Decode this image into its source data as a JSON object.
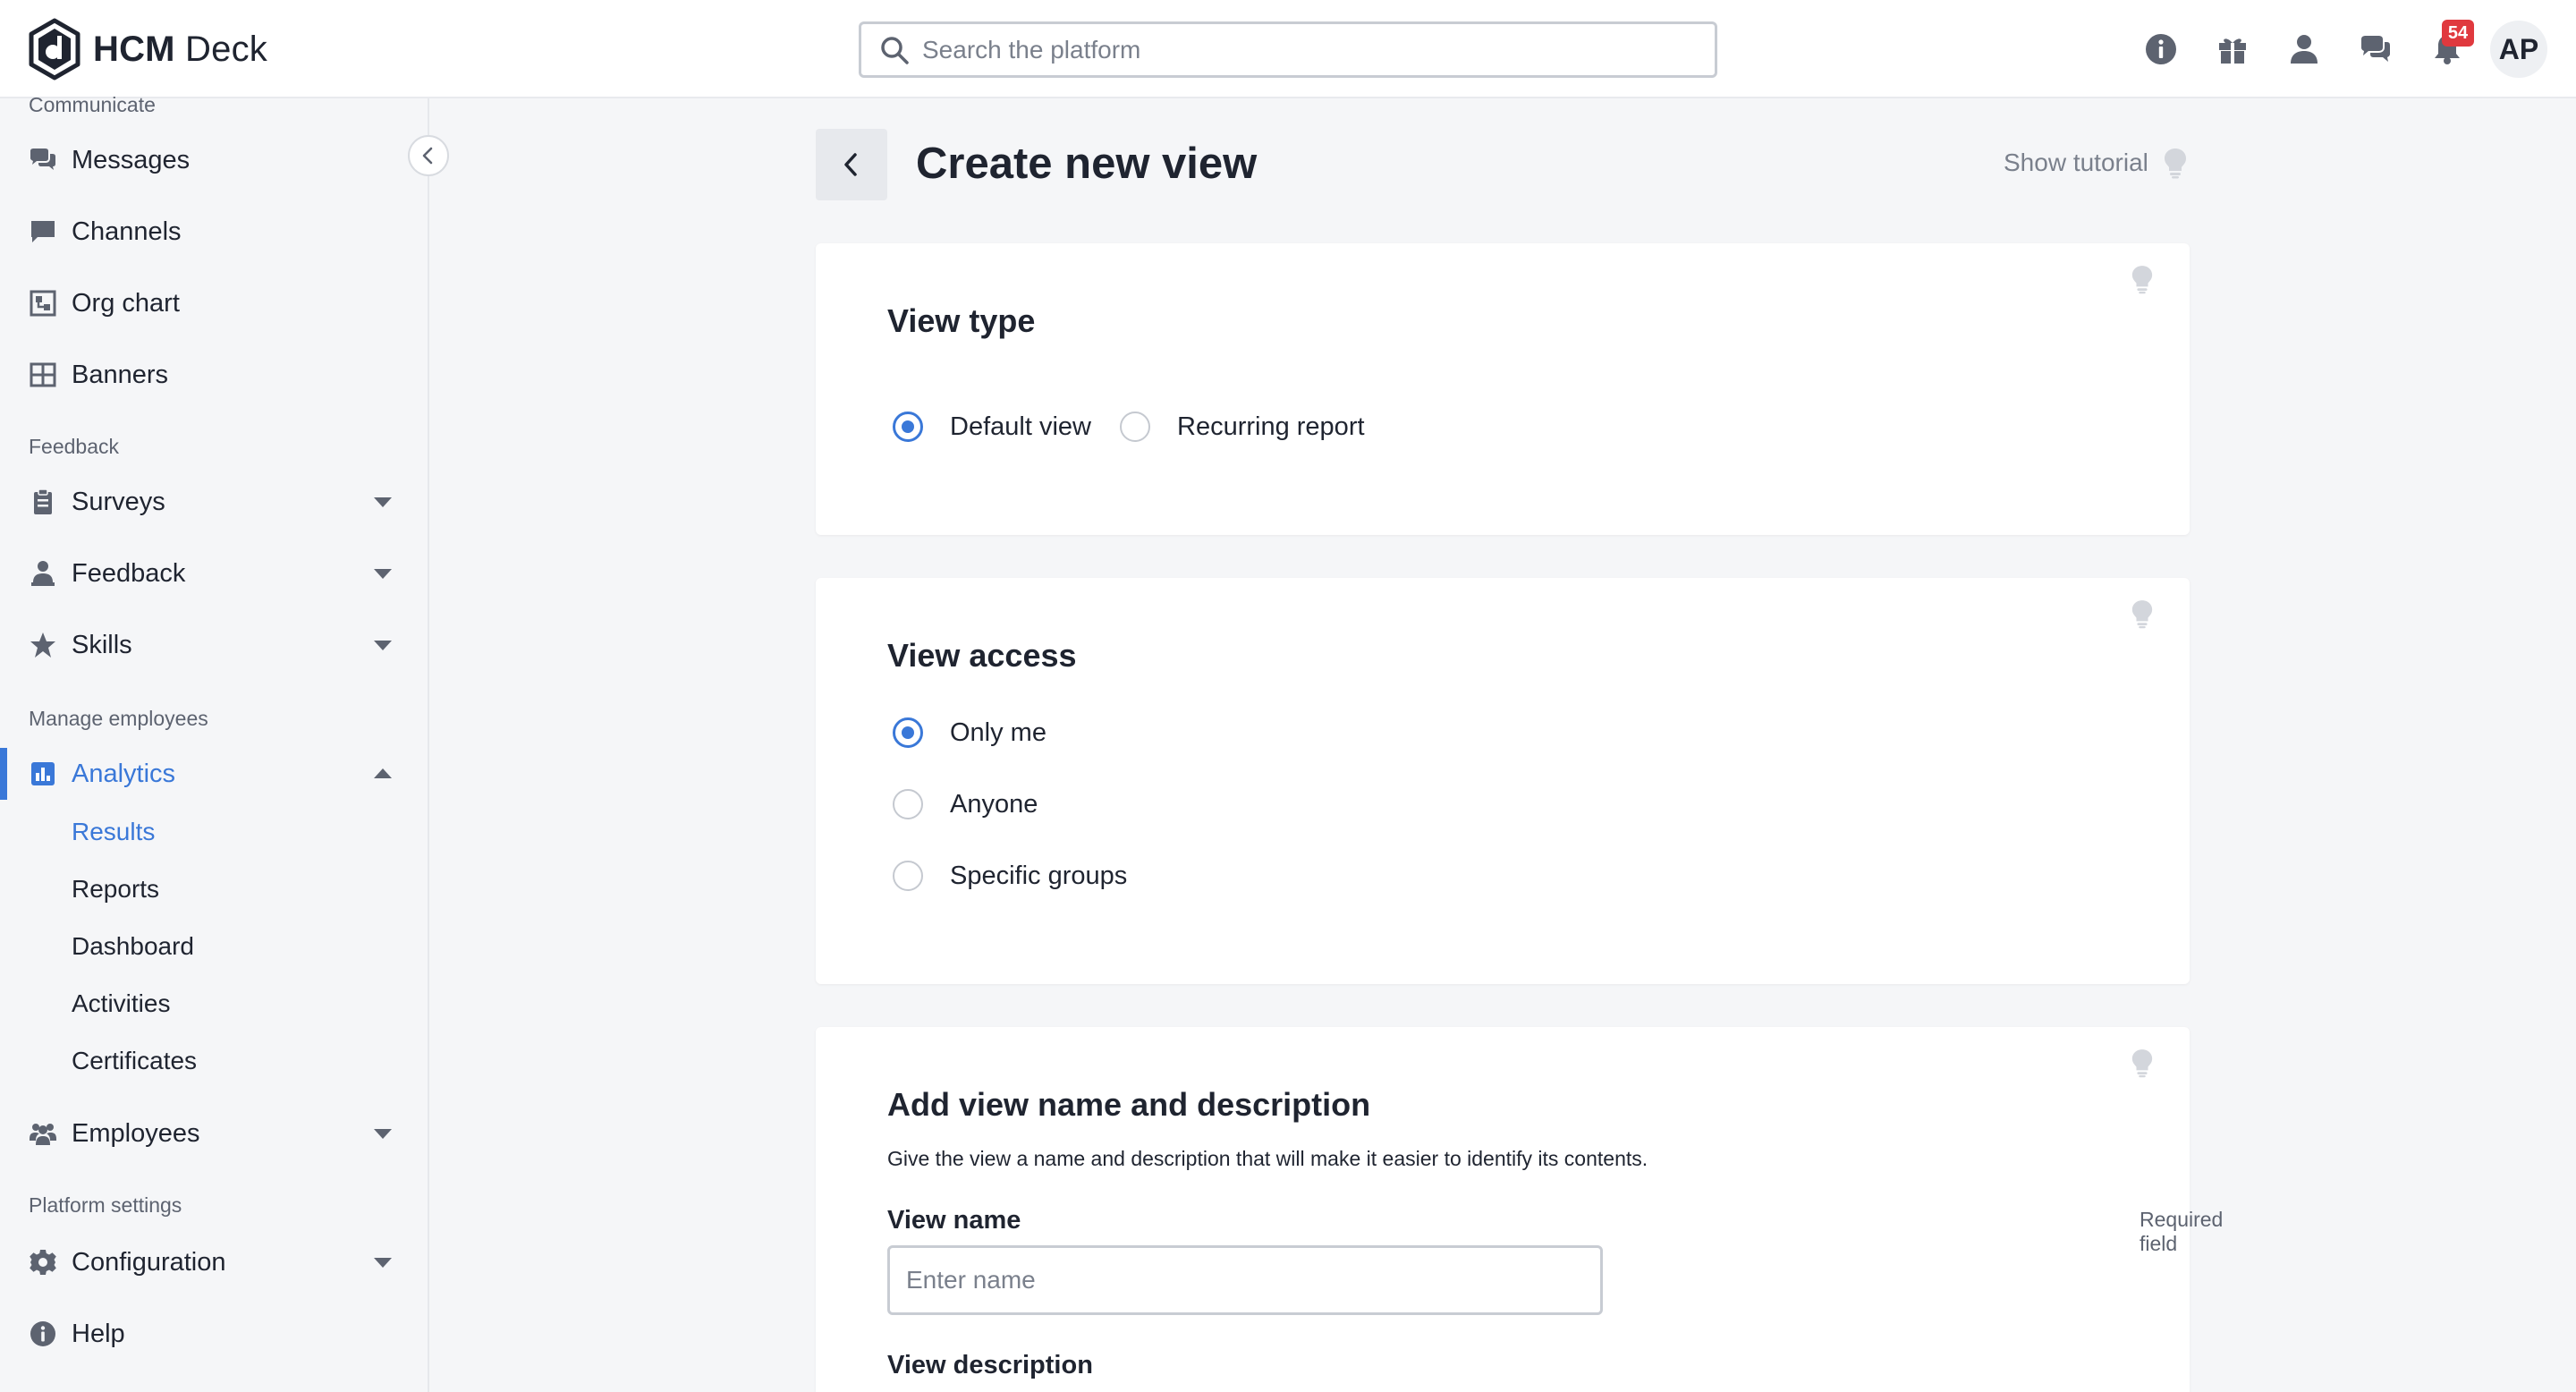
{
  "header": {
    "logo_bold": "HCM",
    "logo_light": "Deck",
    "search_placeholder": "Search the platform",
    "icons": [
      "info-icon",
      "gift-icon",
      "person-icon",
      "chat-icon",
      "bell-icon"
    ],
    "notification_count": "54",
    "avatar_initials": "AP"
  },
  "sidebar": {
    "sections": {
      "communicate": "Communicate",
      "feedback": "Feedback",
      "manage": "Manage employees",
      "platform": "Platform settings"
    },
    "items": {
      "messages": "Messages",
      "channels": "Channels",
      "org_chart": "Org chart",
      "banners": "Banners",
      "surveys": "Surveys",
      "feedback": "Feedback",
      "skills": "Skills",
      "analytics": "Analytics",
      "employees": "Employees",
      "configuration": "Configuration",
      "help": "Help"
    },
    "analytics_sub": {
      "results": "Results",
      "reports": "Reports",
      "dashboard": "Dashboard",
      "activities": "Activities",
      "certificates": "Certificates"
    }
  },
  "main": {
    "title": "Create new view",
    "show_tutorial": "Show tutorial",
    "view_type": {
      "title": "View type",
      "options": [
        "Default view",
        "Recurring report"
      ],
      "selected": "Default view"
    },
    "view_access": {
      "title": "View access",
      "options": [
        "Only me",
        "Anyone",
        "Specific groups"
      ],
      "selected": "Only me"
    },
    "name_desc": {
      "title": "Add view name and description",
      "description": "Give the view a name and description that will make it easier to identify its contents.",
      "name_label": "View name",
      "required": "Required field",
      "name_placeholder": "Enter name",
      "name_value": "",
      "desc_label": "View description"
    }
  },
  "colors": {
    "accent": "#3a78d8",
    "badge": "#e0393e",
    "text": "#1f2430",
    "muted": "#7a808c",
    "background": "#f5f6f8"
  }
}
